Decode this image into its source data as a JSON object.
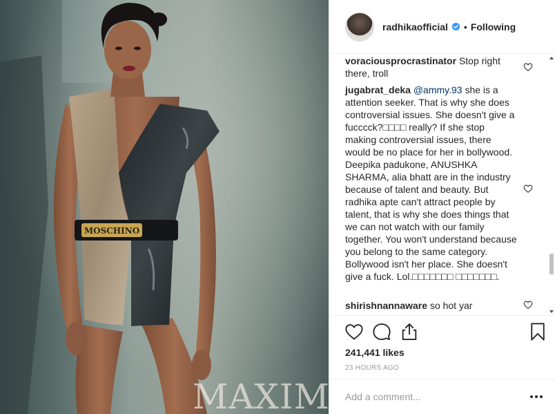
{
  "photo": {
    "watermark": "MAXIM",
    "belt_text": "MOSCHINO"
  },
  "post": {
    "header": {
      "username": "radhikaofficial",
      "verified": true,
      "separator": "•",
      "follow_state": "Following"
    },
    "comments": [
      {
        "user": "voraciousprocrastinator",
        "text": "Stop right there, troll"
      },
      {
        "user": "jugabrat_deka",
        "mention": "@ammy.93",
        "text": "she is a attention seeker. That is why she does controversial issues. She doesn't give a fucccck?□□□□ really? If she stop making controversial issues, there would be no place for her in bollywood. Deepika padukone, ANUSHKA SHARMA, alia bhatt are in the industry because of talent and beauty. But radhika apte can't attract people by talent, that is why she does things that we can not watch with our family together. You won't understand because you belong to the same category. Bollywood isn't her place. She doesn't give a fuck. Lol.□□□□□□□ □□□□□□□."
      },
      {
        "user": "shirishnannaware",
        "text": "so hot yar"
      }
    ],
    "likes": "241,441 likes",
    "time": "23 HOURS AGO",
    "add_comment_placeholder": "Add a comment..."
  },
  "icons": {
    "verified": "verified-badge-icon",
    "like": "heart-icon",
    "comment": "comment-bubble-icon",
    "share": "share-icon",
    "save": "bookmark-icon",
    "more": "more-options-icon"
  },
  "colors": {
    "verified_blue": "#3897f0",
    "text": "#262626",
    "muted": "#999999",
    "mention": "#003569",
    "divider": "#efefef"
  }
}
